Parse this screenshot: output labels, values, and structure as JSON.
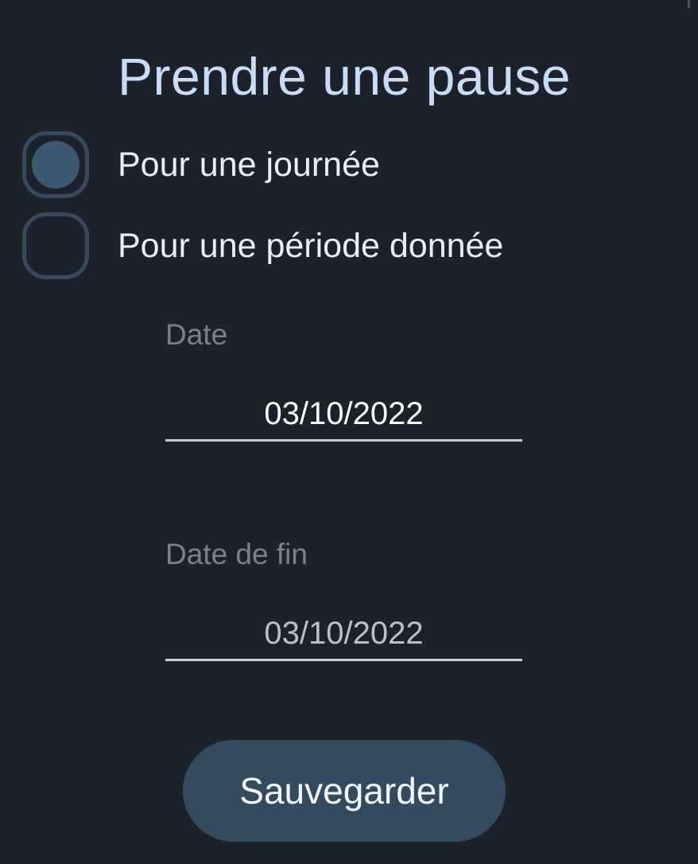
{
  "dialog": {
    "title": "Prendre une pause",
    "options": [
      {
        "label": "Pour une journée",
        "checked": true
      },
      {
        "label": "Pour une période donnée",
        "checked": false
      }
    ],
    "fields": {
      "start": {
        "label": "Date",
        "value": "03/10/2022"
      },
      "end": {
        "label": "Date de fin",
        "value": "03/10/2022"
      }
    },
    "save_label": "Sauvegarder"
  },
  "colors": {
    "background": "#1b222a",
    "title": "#c8dcf6",
    "accent": "#344b5f",
    "checkbox_border": "#364a5b",
    "checkbox_fill": "#3c5870",
    "muted_label": "#7a8188"
  }
}
